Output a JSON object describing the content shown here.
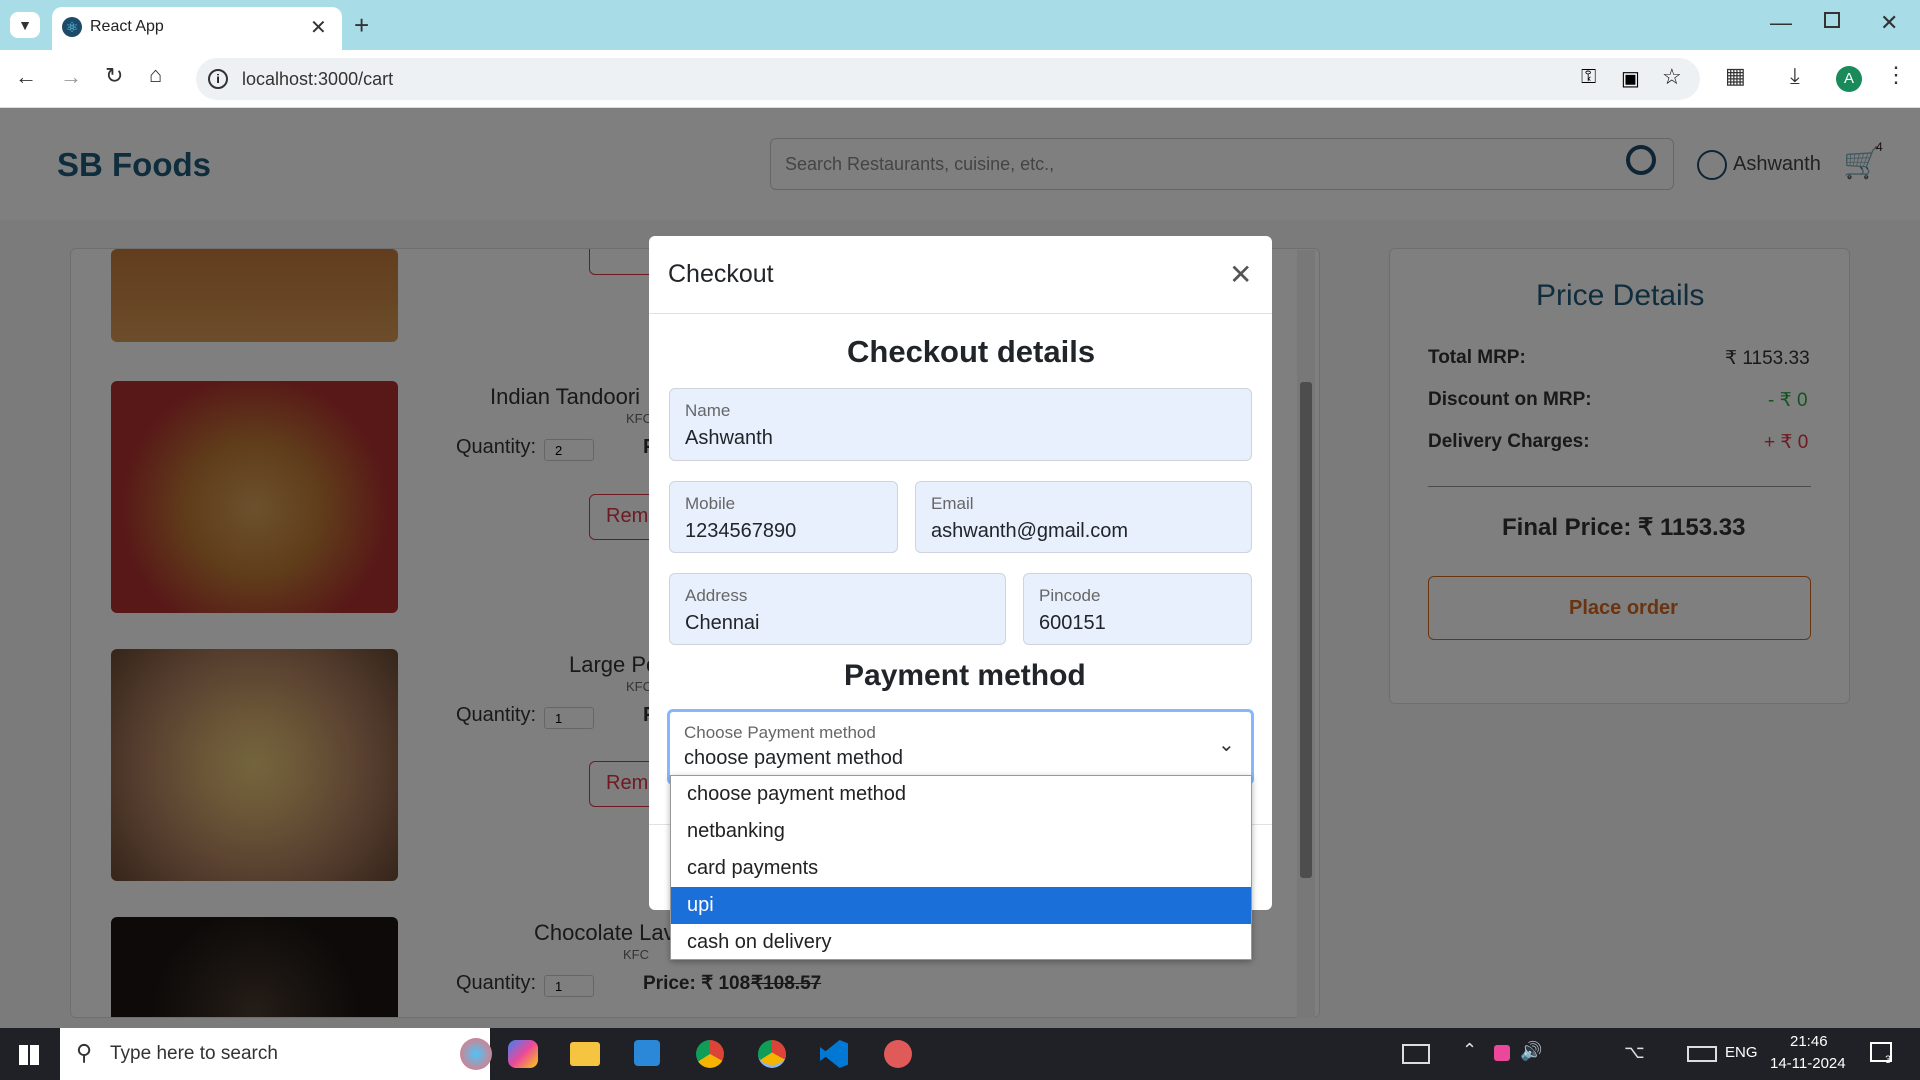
{
  "browser": {
    "tab_title": "React App",
    "url": "localhost:3000/cart",
    "profile_initial": "A"
  },
  "app": {
    "brand": "SB Foods",
    "search_placeholder": "Search Restaurants, cuisine, etc.,",
    "user_name": "Ashwanth",
    "cart_count": "4"
  },
  "cart": {
    "remove_label": "Remo",
    "quantity_label": "Quantity:",
    "items": [
      {
        "name": "Indian Tandoori",
        "restaurant": "KFC",
        "quantity": "2",
        "price_prefix": "P"
      },
      {
        "name": "Large Po",
        "restaurant": "KFC",
        "quantity": "1",
        "price_prefix": "P"
      },
      {
        "name": "Chocolate Lav",
        "restaurant": "KFC",
        "quantity": "1",
        "price_label": "Price: ₹ 108",
        "old_price": "₹108.57"
      }
    ]
  },
  "price_details": {
    "title": "Price Details",
    "total_mrp_label": "Total MRP:",
    "total_mrp_value": "₹ 1153.33",
    "discount_label": "Discount on MRP:",
    "discount_value": "- ₹ 0",
    "delivery_label": "Delivery Charges:",
    "delivery_value": "+ ₹ 0",
    "final_price": "Final Price: ₹ 1153.33",
    "place_order": "Place order"
  },
  "checkout": {
    "modal_title": "Checkout",
    "section_title": "Checkout details",
    "name_label": "Name",
    "name_value": "Ashwanth",
    "mobile_label": "Mobile",
    "mobile_value": "1234567890",
    "email_label": "Email",
    "email_value": "ashwanth@gmail.com",
    "address_label": "Address",
    "address_value": "Chennai",
    "pincode_label": "Pincode",
    "pincode_value": "600151",
    "payment_title": "Payment method",
    "payment_label": "Choose Payment method",
    "payment_value": "choose payment method",
    "payment_options": [
      "choose payment method",
      "netbanking",
      "card payments",
      "upi",
      "cash on delivery"
    ]
  },
  "taskbar": {
    "search_placeholder": "Type here to search",
    "lang": "ENG",
    "time": "21:46",
    "date": "14-11-2024",
    "notif_count": "3"
  },
  "colors": {
    "brand": "#1e5a7a",
    "accent_orange": "#d2691e",
    "danger": "#dc3545",
    "option_selected": "#1a6fd9"
  }
}
